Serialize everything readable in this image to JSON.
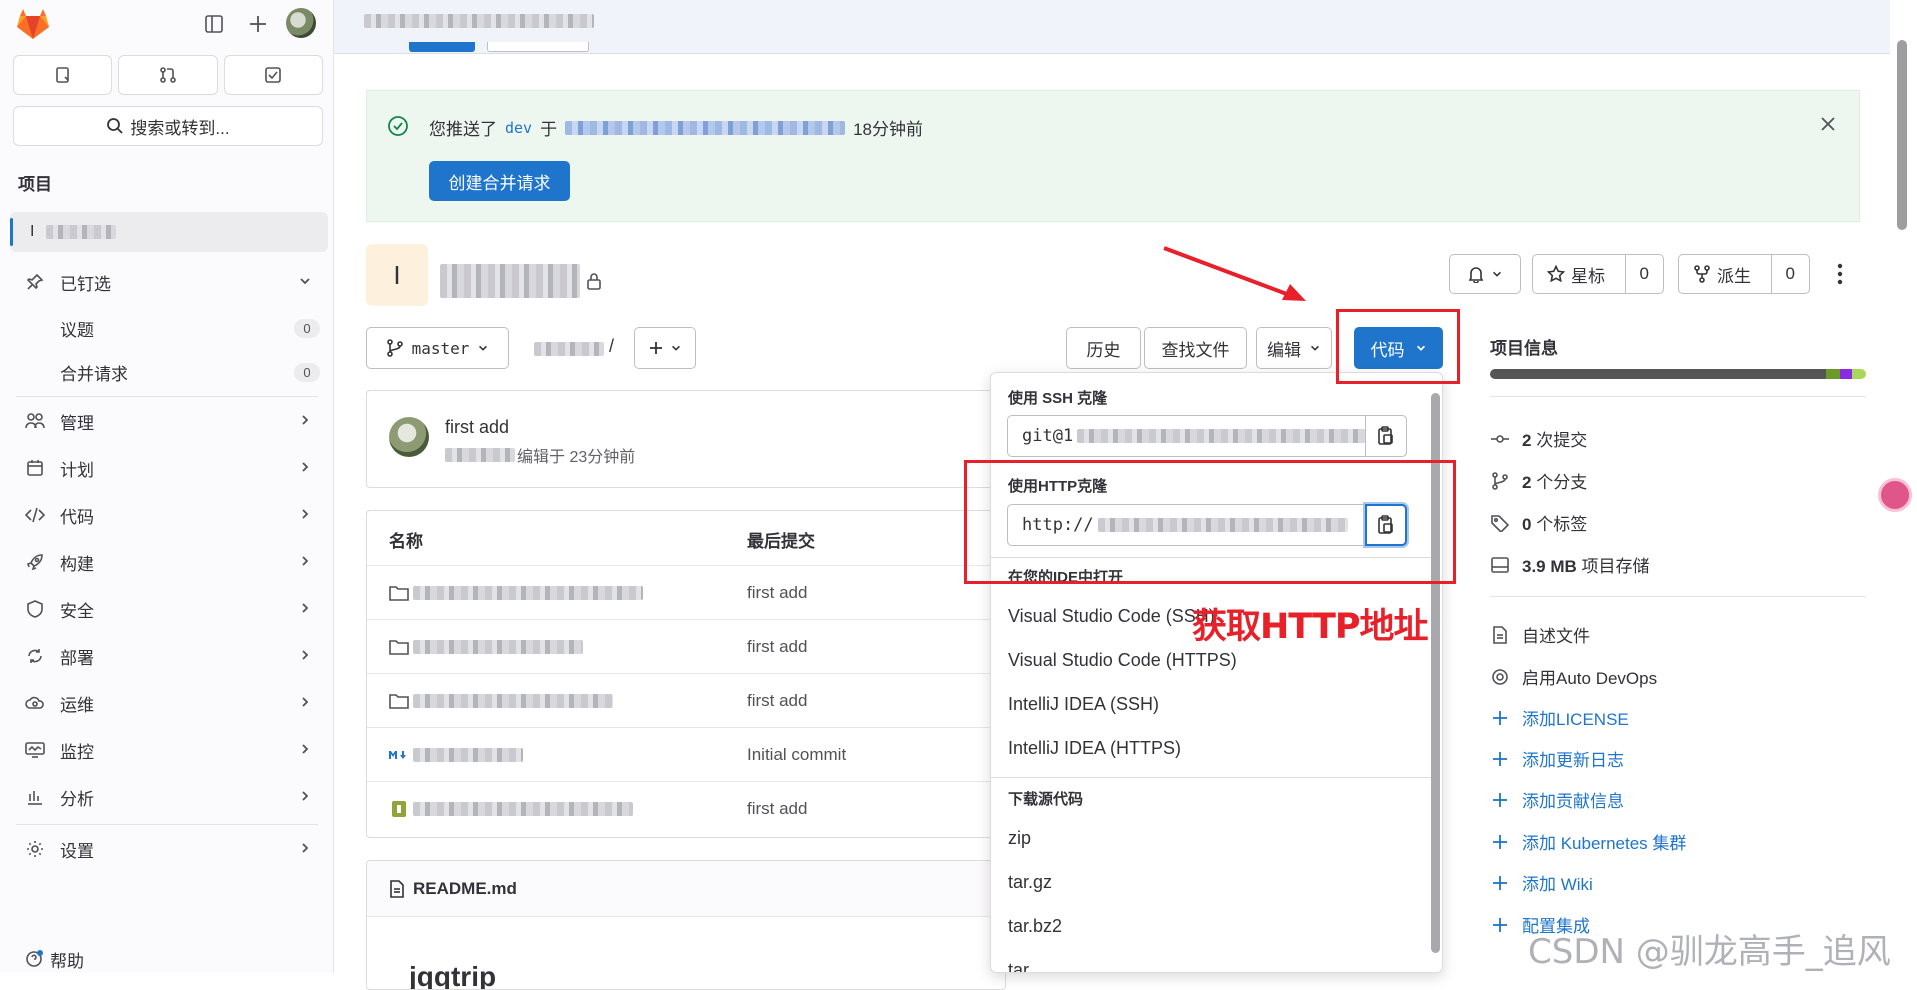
{
  "sidebar": {
    "search_placeholder": "搜索或转到...",
    "section_title": "项目",
    "project_initial": "I",
    "pinned": "已钉选",
    "issues": {
      "label": "议题",
      "count": "0"
    },
    "merge_requests": {
      "label": "合并请求",
      "count": "0"
    },
    "nav": [
      {
        "label": "管理",
        "icon": "users-icon"
      },
      {
        "label": "计划",
        "icon": "calendar-icon"
      },
      {
        "label": "代码",
        "icon": "code-icon"
      },
      {
        "label": "构建",
        "icon": "rocket-icon"
      },
      {
        "label": "安全",
        "icon": "shield-icon"
      },
      {
        "label": "部署",
        "icon": "deploy-icon"
      },
      {
        "label": "运维",
        "icon": "cloud-gear-icon"
      },
      {
        "label": "监控",
        "icon": "monitor-icon"
      },
      {
        "label": "分析",
        "icon": "chart-icon"
      }
    ],
    "settings": "设置",
    "help": "帮助"
  },
  "push_alert": {
    "prefix": "您推送了",
    "branch": "dev",
    "middle": "于",
    "time": "18分钟前",
    "create_mr": "创建合并请求"
  },
  "project": {
    "initial": "I",
    "star_label": "星标",
    "star_count": "0",
    "fork_label": "派生",
    "fork_count": "0"
  },
  "toolbar": {
    "branch": "master",
    "path_sep": "/",
    "history": "历史",
    "find_file": "查找文件",
    "edit": "编辑",
    "code": "代码"
  },
  "commit": {
    "message": "first add",
    "edited": "编辑于 23分钟前"
  },
  "files": {
    "col_name": "名称",
    "col_last_commit": "最后提交",
    "rows": [
      {
        "icon": "folder-icon",
        "commit": "first add"
      },
      {
        "icon": "folder-icon",
        "commit": "first add"
      },
      {
        "icon": "folder-icon",
        "commit": "first add"
      },
      {
        "icon": "markdown-icon",
        "commit": "Initial commit"
      },
      {
        "icon": "file-icon",
        "commit": "first add"
      }
    ]
  },
  "readme": {
    "title": "README.md",
    "heading": "jqqtrip"
  },
  "dropdown": {
    "ssh_title": "使用 SSH 克隆",
    "ssh_value": "git@1",
    "http_title": "使用HTTP克隆",
    "http_value": "http://",
    "ide_title": "在您的IDE中打开",
    "ide_items": [
      "Visual Studio Code (SSH)",
      "Visual Studio Code (HTTPS)",
      "IntelliJ IDEA (SSH)",
      "IntelliJ IDEA (HTTPS)"
    ],
    "download_title": "下载源代码",
    "download_items": [
      "zip",
      "tar.gz",
      "tar.bz2",
      "tar"
    ]
  },
  "project_info": {
    "title": "项目信息",
    "stats": [
      {
        "icon": "commit-icon",
        "count": "2",
        "label": "次提交"
      },
      {
        "icon": "branch-icon",
        "count": "2",
        "label": "个分支"
      },
      {
        "icon": "tag-icon",
        "count": "0",
        "label": "个标签"
      },
      {
        "icon": "storage-icon",
        "count": "3.9 MB",
        "label": "项目存储"
      }
    ],
    "actions": [
      {
        "icon": "doc-icon",
        "label": "自述文件",
        "link": false
      },
      {
        "icon": "gear-icon",
        "label": "启用Auto DevOps",
        "link": false
      },
      {
        "icon": "plus-icon",
        "label": "添加LICENSE",
        "link": true
      },
      {
        "icon": "plus-icon",
        "label": "添加更新日志",
        "link": true
      },
      {
        "icon": "plus-icon",
        "label": "添加贡献信息",
        "link": true
      },
      {
        "icon": "plus-icon",
        "label": "添加 Kubernetes 集群",
        "link": true
      },
      {
        "icon": "plus-icon",
        "label": "添加 Wiki",
        "link": true
      },
      {
        "icon": "plus-icon",
        "label": "配置集成",
        "link": true
      }
    ]
  },
  "annotation": {
    "text": "获取HTTP地址",
    "color": "#e8202a"
  },
  "watermark": "CSDN @驯龙高手_追风",
  "colors": {
    "primary": "#1f75cb",
    "success": "#108548",
    "annotation": "#e8202a"
  }
}
